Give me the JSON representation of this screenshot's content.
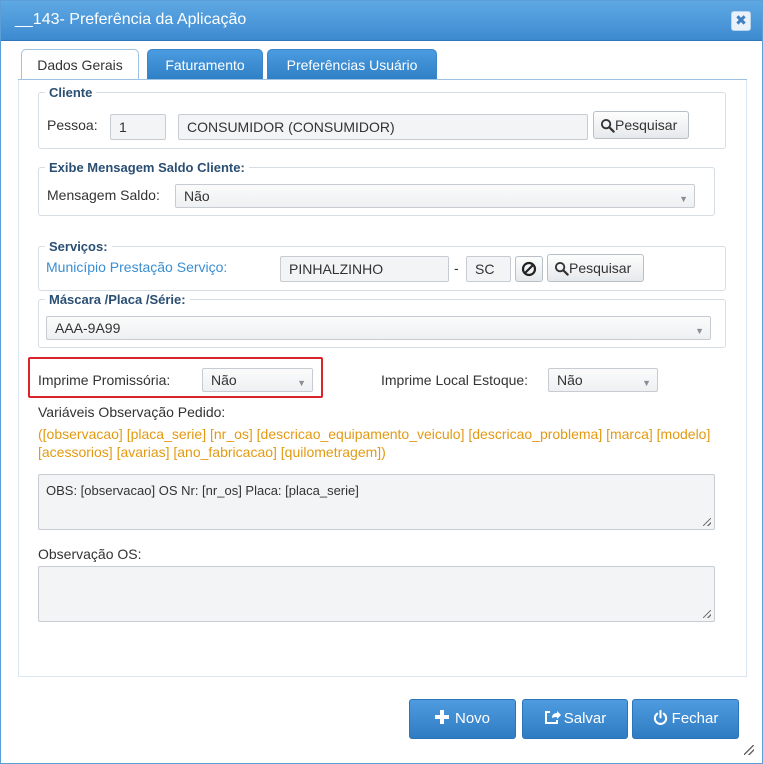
{
  "window": {
    "title": "__143- Preferência da Aplicação",
    "close_glyph": "✖"
  },
  "tabs": [
    {
      "label": "Dados Gerais",
      "active": true
    },
    {
      "label": "Faturamento",
      "active": false
    },
    {
      "label": "Preferências Usuário",
      "active": false
    }
  ],
  "cliente": {
    "legend": "Cliente",
    "pessoa_label": "Pessoa:",
    "pessoa_code": "1",
    "pessoa_name": "CONSUMIDOR (CONSUMIDOR)",
    "search_label": "Pesquisar"
  },
  "mensagem_saldo": {
    "legend": "Exibe Mensagem Saldo Cliente:",
    "label": "Mensagem Saldo:",
    "value": "Não"
  },
  "servicos": {
    "legend": "Serviços:",
    "municipio_label": "Município Prestação Serviço:",
    "municipio_value": "PINHALZINHO",
    "separator": "-",
    "uf_value": "SC",
    "search_label": "Pesquisar"
  },
  "mascara": {
    "legend": "Máscara /Placa /Série:",
    "value": "AAA-9A99"
  },
  "imprime_promissoria": {
    "label": "Imprime Promissória:",
    "value": "Não"
  },
  "imprime_local_estoque": {
    "label": "Imprime Local Estoque:",
    "value": "Não"
  },
  "variaveis": {
    "label": "Variáveis Observação Pedido:",
    "text": "([observacao] [placa_serie] [nr_os] [descricao_equipamento_veiculo] [descricao_problema] [marca] [modelo] [acessorios] [avarias] [ano_fabricacao] [quilometragem])"
  },
  "observacao_pedido": {
    "value": "OBS: [observacao] OS Nr: [nr_os]  Placa: [placa_serie]"
  },
  "observacao_os": {
    "label": "Observação OS:",
    "value": ""
  },
  "footer": {
    "novo_label": "Novo",
    "salvar_label": "Salvar",
    "fechar_label": "Fechar"
  },
  "colors": {
    "accent": "#3d8ad0",
    "variables_text": "#e39a12",
    "highlight_border": "#d9252a"
  }
}
